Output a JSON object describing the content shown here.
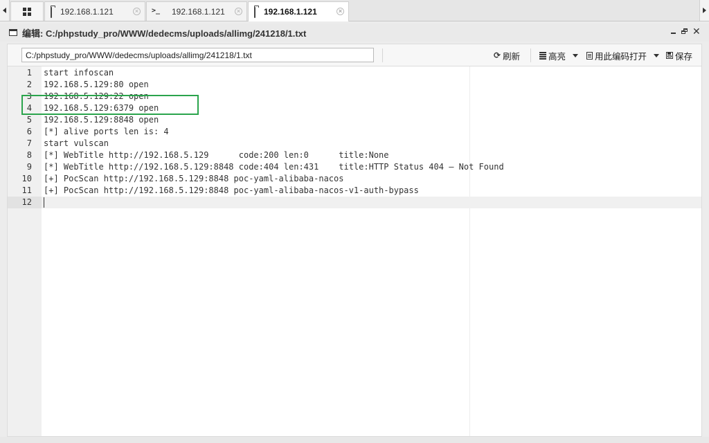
{
  "tabs": [
    {
      "label": "192.168.1.121",
      "icon": "folder-icon"
    },
    {
      "label": "192.168.1.121",
      "icon": "terminal-icon"
    },
    {
      "label": "192.168.1.121",
      "icon": "folder-icon",
      "active": true
    }
  ],
  "panel": {
    "title": "编辑: C:/phpstudy_pro/WWW/dedecms/uploads/allimg/241218/1.txt"
  },
  "toolbar": {
    "path_value": "C:/phpstudy_pro/WWW/dedecms/uploads/allimg/241218/1.txt",
    "refresh_label": "刷新",
    "highlight_label": "高亮",
    "open_with_encoding_label": "用此编码打开",
    "save_label": "保存"
  },
  "editor": {
    "active_line": 12,
    "lines": [
      {
        "num": "1",
        "text": "start infoscan"
      },
      {
        "num": "2",
        "text": "192.168.5.129:80 open"
      },
      {
        "num": "3",
        "text": "192.168.5.129:22 open"
      },
      {
        "num": "4",
        "text": "192.168.5.129:6379 open"
      },
      {
        "num": "5",
        "text": "192.168.5.129:8848 open"
      },
      {
        "num": "6",
        "text": "[*] alive ports len is: 4"
      },
      {
        "num": "7",
        "text": "start vulscan"
      },
      {
        "num": "8",
        "text": "[*] WebTitle http://192.168.5.129      code:200 len:0      title:None"
      },
      {
        "num": "9",
        "text": "[*] WebTitle http://192.168.5.129:8848 code:404 len:431    title:HTTP Status 404 – Not Found"
      },
      {
        "num": "10",
        "text": "[+] PocScan http://192.168.5.129:8848 poc-yaml-alibaba-nacos"
      },
      {
        "num": "11",
        "text": "[+] PocScan http://192.168.5.129:8848 poc-yaml-alibaba-nacos-v1-auth-bypass"
      },
      {
        "num": "12",
        "text": ""
      }
    ]
  },
  "colors": {
    "annotation_box": "#2aa44c",
    "active_line_bg": "#f0f0f0"
  }
}
